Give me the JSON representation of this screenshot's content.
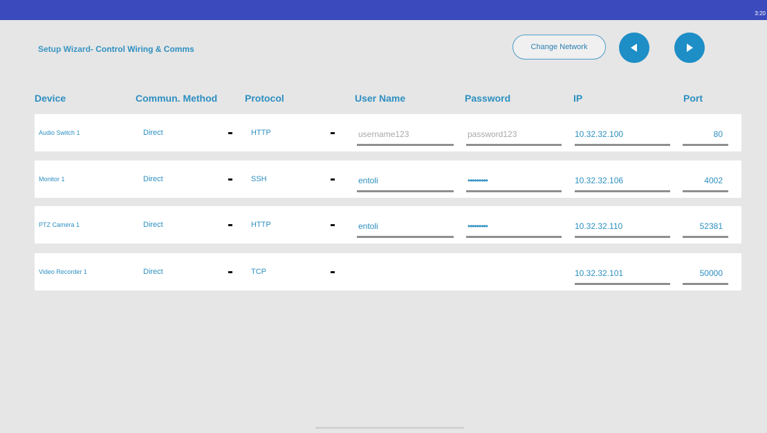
{
  "status_bar": {
    "time": "3:20",
    "color": "#3b4bbd"
  },
  "header": {
    "title_prefix": "Setup Wizard-",
    "title_main": "Control Wiring & Comms",
    "change_network_label": "Change Network",
    "back_icon": "triangle-left-icon",
    "forward_icon": "triangle-right-icon",
    "accent": "#1e8ec6"
  },
  "columns": {
    "device": "Device",
    "method": "Commun. Method",
    "protocol": "Protocol",
    "username": "User Name",
    "password": "Password",
    "ip": "IP",
    "port": "Port"
  },
  "rows": [
    {
      "device": "Audio Switch 1",
      "method": "Direct",
      "protocol": "HTTP",
      "username": "",
      "username_placeholder": "username123",
      "password": "",
      "password_placeholder": "password123",
      "ip": "10.32.32.100",
      "port": "80"
    },
    {
      "device": "Monitor 1",
      "method": "Direct",
      "protocol": "SSH",
      "username": "entoli",
      "password": "•••••••••",
      "ip": "10.32.32.106",
      "port": "4002"
    },
    {
      "device": "PTZ Camera 1",
      "method": "Direct",
      "protocol": "HTTP",
      "username": "entoli",
      "password": "•••••••••",
      "ip": "10.32.32.110",
      "port": "52381"
    },
    {
      "device": "Video Recorder 1",
      "method": "Direct",
      "protocol": "TCP",
      "ip": "10.32.32.101",
      "port": "50000"
    }
  ]
}
